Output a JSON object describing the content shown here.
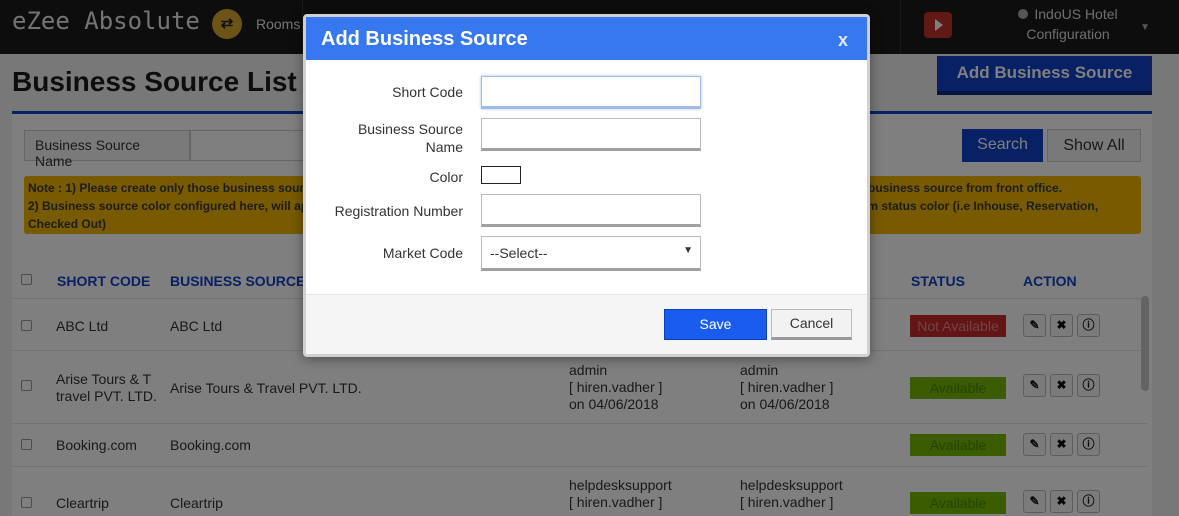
{
  "app": {
    "logo_text": "eZee Absolute",
    "nav_rooms": "Rooms",
    "hotel_line1": "IndoUS Hotel",
    "hotel_line2": "Configuration"
  },
  "page": {
    "title": "Business Source List",
    "add_button": "Add Business Source"
  },
  "search": {
    "label": "Business Source Name",
    "search_button": "Search",
    "show_all_button": "Show All"
  },
  "note": {
    "line1_left": "Note : 1) Please create only those business sour",
    "line1_right": "business source from front office.",
    "line2_left": "2) Business source color configured here, will ap",
    "line2_right": "om status color (i.e Inhouse, Reservation,",
    "line3": "Checked Out)"
  },
  "table": {
    "headers": {
      "short_code": "SHORT CODE",
      "business_source": "BUSINESS SOURCE",
      "status": "STATUS",
      "action": "ACTION"
    },
    "rows": [
      {
        "short_code": "ABC Ltd",
        "name": "ABC Ltd",
        "created_by": "",
        "updated_by": "",
        "status": "Not Available"
      },
      {
        "short_code": "Arise Tours & T\ntravel PVT. LTD.",
        "name": "Arise Tours & Travel PVT. LTD.",
        "created_by": "admin\n[ hiren.vadher ]\non 04/06/2018",
        "updated_by": "admin\n[ hiren.vadher ]\non 04/06/2018",
        "status": "Available"
      },
      {
        "short_code": "Booking.com",
        "name": "Booking.com",
        "created_by": "",
        "updated_by": "",
        "status": "Available"
      },
      {
        "short_code": "Cleartrip",
        "name": "Cleartrip",
        "created_by": "helpdesksupport\n[ hiren.vadher ]",
        "updated_by": "helpdesksupport\n[ hiren.vadher ]",
        "status": "Available"
      }
    ]
  },
  "modal": {
    "title": "Add Business Source",
    "close": "x",
    "short_code_label": "Short Code",
    "name_label": "Business Source\nName",
    "color_label": "Color",
    "registration_label": "Registration Number",
    "market_code_label": "Market Code",
    "market_code_value": "--Select--",
    "save": "Save",
    "cancel": "Cancel"
  },
  "colors": {
    "brand_blue": "#1040c8",
    "modal_header": "#3777f0",
    "status_available": "#76b900",
    "status_not_available": "#c62828",
    "note_bg": "#f0b400"
  }
}
